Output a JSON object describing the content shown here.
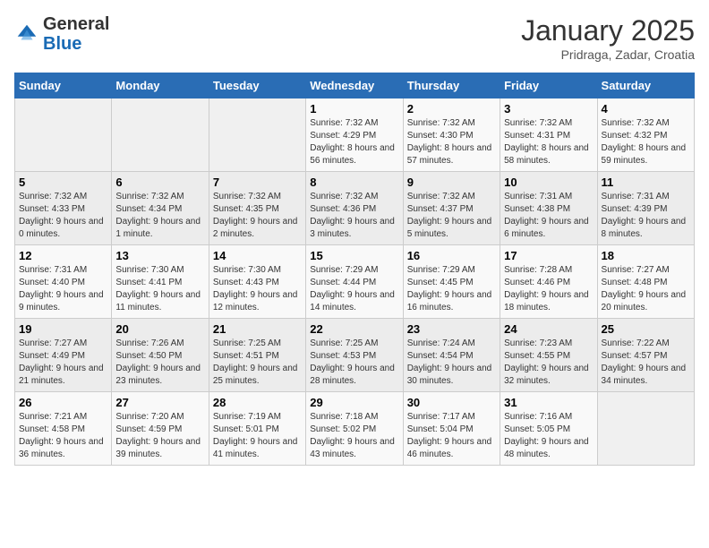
{
  "header": {
    "logo_general": "General",
    "logo_blue": "Blue",
    "title": "January 2025",
    "subtitle": "Pridraga, Zadar, Croatia"
  },
  "weekdays": [
    "Sunday",
    "Monday",
    "Tuesday",
    "Wednesday",
    "Thursday",
    "Friday",
    "Saturday"
  ],
  "weeks": [
    [
      {
        "day": "",
        "info": ""
      },
      {
        "day": "",
        "info": ""
      },
      {
        "day": "",
        "info": ""
      },
      {
        "day": "1",
        "info": "Sunrise: 7:32 AM\nSunset: 4:29 PM\nDaylight: 8 hours and 56 minutes."
      },
      {
        "day": "2",
        "info": "Sunrise: 7:32 AM\nSunset: 4:30 PM\nDaylight: 8 hours and 57 minutes."
      },
      {
        "day": "3",
        "info": "Sunrise: 7:32 AM\nSunset: 4:31 PM\nDaylight: 8 hours and 58 minutes."
      },
      {
        "day": "4",
        "info": "Sunrise: 7:32 AM\nSunset: 4:32 PM\nDaylight: 8 hours and 59 minutes."
      }
    ],
    [
      {
        "day": "5",
        "info": "Sunrise: 7:32 AM\nSunset: 4:33 PM\nDaylight: 9 hours and 0 minutes."
      },
      {
        "day": "6",
        "info": "Sunrise: 7:32 AM\nSunset: 4:34 PM\nDaylight: 9 hours and 1 minute."
      },
      {
        "day": "7",
        "info": "Sunrise: 7:32 AM\nSunset: 4:35 PM\nDaylight: 9 hours and 2 minutes."
      },
      {
        "day": "8",
        "info": "Sunrise: 7:32 AM\nSunset: 4:36 PM\nDaylight: 9 hours and 3 minutes."
      },
      {
        "day": "9",
        "info": "Sunrise: 7:32 AM\nSunset: 4:37 PM\nDaylight: 9 hours and 5 minutes."
      },
      {
        "day": "10",
        "info": "Sunrise: 7:31 AM\nSunset: 4:38 PM\nDaylight: 9 hours and 6 minutes."
      },
      {
        "day": "11",
        "info": "Sunrise: 7:31 AM\nSunset: 4:39 PM\nDaylight: 9 hours and 8 minutes."
      }
    ],
    [
      {
        "day": "12",
        "info": "Sunrise: 7:31 AM\nSunset: 4:40 PM\nDaylight: 9 hours and 9 minutes."
      },
      {
        "day": "13",
        "info": "Sunrise: 7:30 AM\nSunset: 4:41 PM\nDaylight: 9 hours and 11 minutes."
      },
      {
        "day": "14",
        "info": "Sunrise: 7:30 AM\nSunset: 4:43 PM\nDaylight: 9 hours and 12 minutes."
      },
      {
        "day": "15",
        "info": "Sunrise: 7:29 AM\nSunset: 4:44 PM\nDaylight: 9 hours and 14 minutes."
      },
      {
        "day": "16",
        "info": "Sunrise: 7:29 AM\nSunset: 4:45 PM\nDaylight: 9 hours and 16 minutes."
      },
      {
        "day": "17",
        "info": "Sunrise: 7:28 AM\nSunset: 4:46 PM\nDaylight: 9 hours and 18 minutes."
      },
      {
        "day": "18",
        "info": "Sunrise: 7:27 AM\nSunset: 4:48 PM\nDaylight: 9 hours and 20 minutes."
      }
    ],
    [
      {
        "day": "19",
        "info": "Sunrise: 7:27 AM\nSunset: 4:49 PM\nDaylight: 9 hours and 21 minutes."
      },
      {
        "day": "20",
        "info": "Sunrise: 7:26 AM\nSunset: 4:50 PM\nDaylight: 9 hours and 23 minutes."
      },
      {
        "day": "21",
        "info": "Sunrise: 7:25 AM\nSunset: 4:51 PM\nDaylight: 9 hours and 25 minutes."
      },
      {
        "day": "22",
        "info": "Sunrise: 7:25 AM\nSunset: 4:53 PM\nDaylight: 9 hours and 28 minutes."
      },
      {
        "day": "23",
        "info": "Sunrise: 7:24 AM\nSunset: 4:54 PM\nDaylight: 9 hours and 30 minutes."
      },
      {
        "day": "24",
        "info": "Sunrise: 7:23 AM\nSunset: 4:55 PM\nDaylight: 9 hours and 32 minutes."
      },
      {
        "day": "25",
        "info": "Sunrise: 7:22 AM\nSunset: 4:57 PM\nDaylight: 9 hours and 34 minutes."
      }
    ],
    [
      {
        "day": "26",
        "info": "Sunrise: 7:21 AM\nSunset: 4:58 PM\nDaylight: 9 hours and 36 minutes."
      },
      {
        "day": "27",
        "info": "Sunrise: 7:20 AM\nSunset: 4:59 PM\nDaylight: 9 hours and 39 minutes."
      },
      {
        "day": "28",
        "info": "Sunrise: 7:19 AM\nSunset: 5:01 PM\nDaylight: 9 hours and 41 minutes."
      },
      {
        "day": "29",
        "info": "Sunrise: 7:18 AM\nSunset: 5:02 PM\nDaylight: 9 hours and 43 minutes."
      },
      {
        "day": "30",
        "info": "Sunrise: 7:17 AM\nSunset: 5:04 PM\nDaylight: 9 hours and 46 minutes."
      },
      {
        "day": "31",
        "info": "Sunrise: 7:16 AM\nSunset: 5:05 PM\nDaylight: 9 hours and 48 minutes."
      },
      {
        "day": "",
        "info": ""
      }
    ]
  ]
}
